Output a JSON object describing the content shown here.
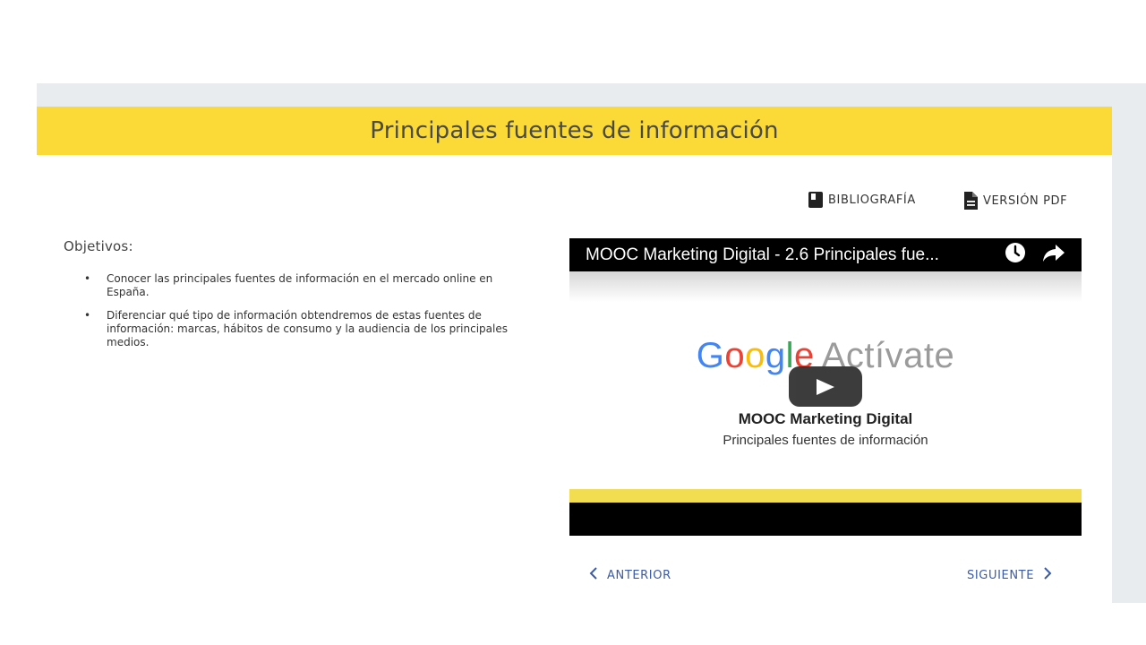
{
  "page": {
    "title": "Principales fuentes de información"
  },
  "toolbar": {
    "bibliography_label": "BIBLIOGRAFÍA",
    "pdf_label": "VERSIÓN PDF"
  },
  "objectives": {
    "heading": "Objetivos:",
    "items": [
      "Conocer las principales fuentes de información en el mercado online en España.",
      "Diferenciar qué tipo de información obtendremos de estas fuentes de información: marcas, hábitos de consumo y la audiencia de los principales medios."
    ]
  },
  "video": {
    "title": "MOOC Marketing Digital - 2.6 Principales fue...",
    "brand_google": [
      "G",
      "o",
      "o",
      "g",
      "l",
      "e"
    ],
    "brand_suffix": "Actívate",
    "heading": "MOOC Marketing Digital",
    "subheading": "Principales fuentes de información",
    "icons": [
      "clock-icon",
      "share-icon",
      "play-icon"
    ]
  },
  "navigation": {
    "prev_label": "ANTERIOR",
    "next_label": "SIGUIENTE"
  },
  "colors": {
    "title_bar": "#fbd936",
    "outer_bg": "#e9ecef",
    "link": "#3b5ba8",
    "video_stripe": "#f2dc4f"
  }
}
